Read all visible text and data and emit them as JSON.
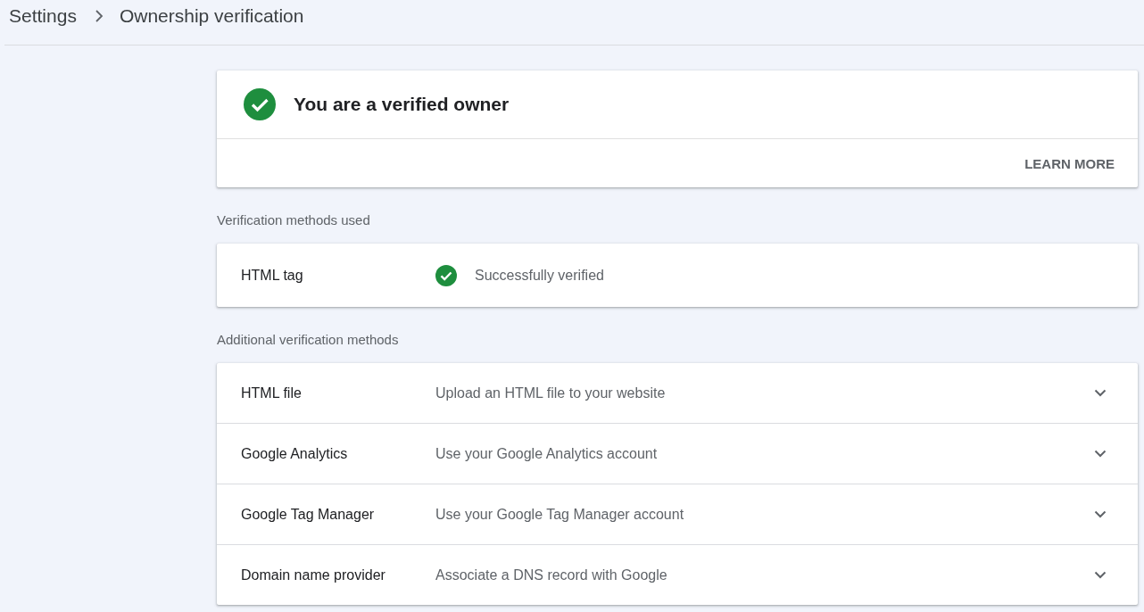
{
  "breadcrumb": {
    "parent": "Settings",
    "current": "Ownership verification"
  },
  "status_card": {
    "title": "You are a verified owner",
    "action": "LEARN MORE"
  },
  "used_methods": {
    "heading": "Verification methods used",
    "items": [
      {
        "name": "HTML tag",
        "status": "Successfully verified"
      }
    ]
  },
  "additional_methods": {
    "heading": "Additional verification methods",
    "items": [
      {
        "name": "HTML file",
        "description": "Upload an HTML file to your website",
        "expanded": false
      },
      {
        "name": "Google Analytics",
        "description": "Use your Google Analytics account",
        "expanded": false
      },
      {
        "name": "Google Tag Manager",
        "description": "Use your Google Tag Manager account",
        "expanded": false
      },
      {
        "name": "Domain name provider",
        "description": "Associate a DNS record with Google",
        "expanded": false
      }
    ]
  }
}
